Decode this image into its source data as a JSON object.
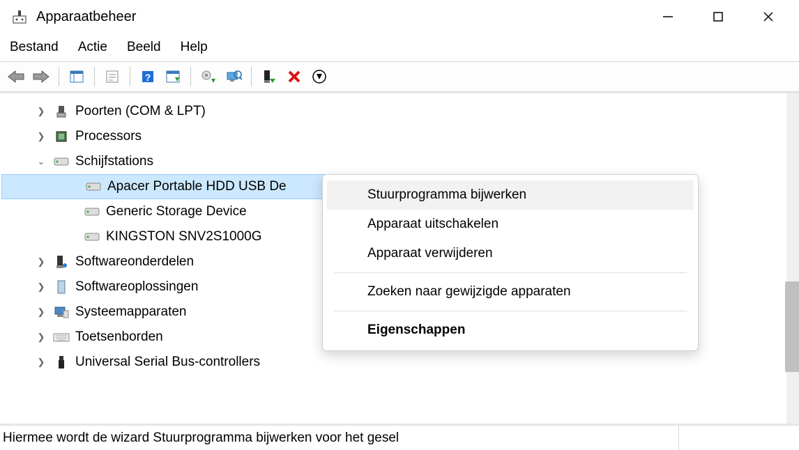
{
  "window": {
    "title": "Apparaatbeheer"
  },
  "menu": {
    "file": "Bestand",
    "action": "Actie",
    "view": "Beeld",
    "help": "Help"
  },
  "tree": {
    "ports": "Poorten (COM & LPT)",
    "processors": "Processors",
    "disk_drives": "Schijfstations",
    "disk_children": {
      "apacer": "Apacer Portable HDD USB De",
      "generic": "Generic Storage Device",
      "kingston": "KINGSTON SNV2S1000G"
    },
    "sw_components": "Softwareonderdelen",
    "sw_solutions": "Softwareoplossingen",
    "system_devices": "Systeemapparaten",
    "keyboards": "Toetsenborden",
    "usb": "Universal Serial Bus-controllers"
  },
  "context_menu": {
    "update_driver": "Stuurprogramma bijwerken",
    "disable": "Apparaat uitschakelen",
    "uninstall": "Apparaat verwijderen",
    "scan": "Zoeken naar gewijzigde apparaten",
    "properties": "Eigenschappen"
  },
  "status": "Hiermee wordt de wizard Stuurprogramma bijwerken voor het gesel"
}
